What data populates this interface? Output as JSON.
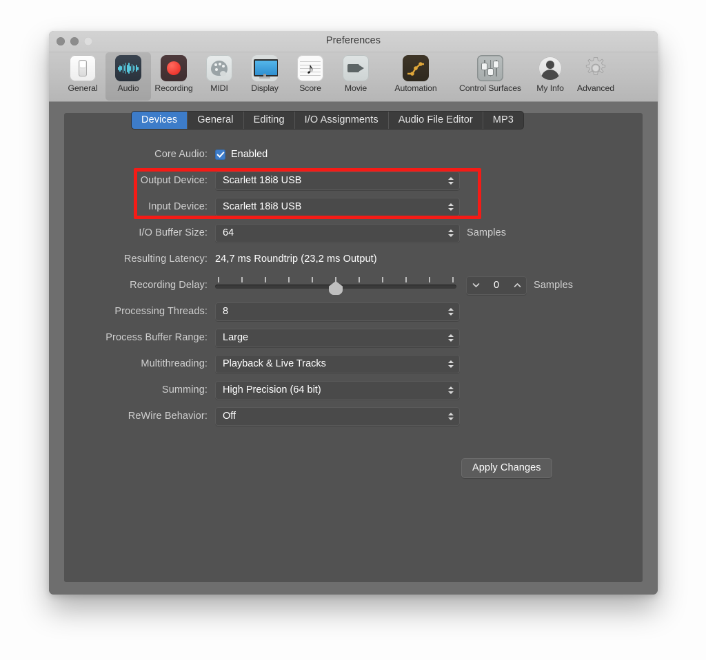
{
  "window": {
    "title": "Preferences",
    "traffic_lights": [
      "close-button",
      "minimize-button",
      "zoom-button"
    ]
  },
  "toolbar": {
    "items": [
      {
        "label": "General",
        "icon": "general-switch-icon",
        "selected": false
      },
      {
        "label": "Audio",
        "icon": "audio-waveform-icon",
        "selected": true
      },
      {
        "label": "Recording",
        "icon": "record-dot-icon",
        "selected": false
      },
      {
        "label": "MIDI",
        "icon": "midi-palette-icon",
        "selected": false
      },
      {
        "label": "Display",
        "icon": "display-monitor-icon",
        "selected": false
      },
      {
        "label": "Score",
        "icon": "score-note-icon",
        "selected": false
      },
      {
        "label": "Movie",
        "icon": "movie-camera-icon",
        "selected": false
      },
      {
        "label": "Automation",
        "icon": "automation-curve-icon",
        "selected": false
      },
      {
        "label": "Control Surfaces",
        "icon": "control-faders-icon",
        "selected": false
      },
      {
        "label": "My Info",
        "icon": "user-avatar-icon",
        "selected": false
      },
      {
        "label": "Advanced",
        "icon": "gear-icon",
        "selected": false
      }
    ]
  },
  "tabs": [
    {
      "label": "Devices",
      "active": true
    },
    {
      "label": "General",
      "active": false
    },
    {
      "label": "Editing",
      "active": false
    },
    {
      "label": "I/O Assignments",
      "active": false
    },
    {
      "label": "Audio File Editor",
      "active": false
    },
    {
      "label": "MP3",
      "active": false
    }
  ],
  "settings": {
    "core_audio": {
      "label": "Core Audio:",
      "checkbox_label": "Enabled",
      "checked": true
    },
    "output_device": {
      "label": "Output Device:",
      "value": "Scarlett 18i8 USB"
    },
    "input_device": {
      "label": "Input Device:",
      "value": "Scarlett 18i8 USB"
    },
    "io_buffer_size": {
      "label": "I/O Buffer Size:",
      "value": "64",
      "unit": "Samples"
    },
    "resulting_latency": {
      "label": "Resulting Latency:",
      "value": "24,7 ms Roundtrip (23,2 ms Output)"
    },
    "recording_delay": {
      "label": "Recording Delay:",
      "value": "0",
      "unit": "Samples",
      "slider_position_percent": 50,
      "tick_count": 11
    },
    "processing_threads": {
      "label": "Processing Threads:",
      "value": "8"
    },
    "process_buffer_range": {
      "label": "Process Buffer Range:",
      "value": "Large"
    },
    "multithreading": {
      "label": "Multithreading:",
      "value": "Playback & Live Tracks"
    },
    "summing": {
      "label": "Summing:",
      "value": "High Precision (64 bit)"
    },
    "rewire_behavior": {
      "label": "ReWire Behavior:",
      "value": "Off"
    }
  },
  "apply_button": {
    "label": "Apply Changes"
  },
  "annotation": {
    "type": "red-highlight-rectangle",
    "color": "#f51b16",
    "targets": [
      "output_device",
      "input_device"
    ]
  },
  "colors": {
    "accent_blue": "#3d7cc9",
    "panel_bg": "#525252",
    "window_bg": "#6e6e6e",
    "field_bg": "#4a4a4a",
    "annotation_red": "#f51b16"
  }
}
